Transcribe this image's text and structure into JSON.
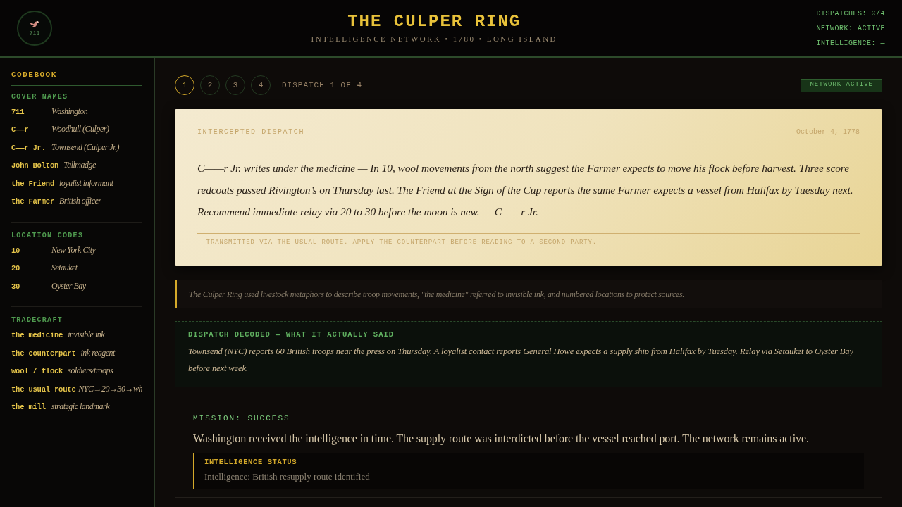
{
  "header": {
    "logo_text": "711",
    "title": "THE CULPER RING",
    "subtitle": "INTELLIGENCE NETWORK • 1780 • LONG ISLAND",
    "status": [
      "DISPATCHES: 0/4",
      "NETWORK: ACTIVE",
      "INTELLIGENCE: —"
    ]
  },
  "sidebar": {
    "title": "CODEBOOK",
    "sections": [
      {
        "title": "COVER NAMES",
        "entries": [
          {
            "code": "711",
            "meaning": "Washington"
          },
          {
            "code": "C——r",
            "meaning": "Woodhull (Culper)"
          },
          {
            "code": "C——r Jr.",
            "meaning": "Townsend (Culper Jr.)"
          },
          {
            "code": "John Bolton",
            "meaning": "Tallmadge"
          },
          {
            "code": "the Friend",
            "meaning": "loyalist informant"
          },
          {
            "code": "the Farmer",
            "meaning": "British officer"
          }
        ]
      },
      {
        "title": "LOCATION CODES",
        "entries": [
          {
            "code": "10",
            "meaning": "New York City"
          },
          {
            "code": "20",
            "meaning": "Setauket"
          },
          {
            "code": "30",
            "meaning": "Oyster Bay"
          }
        ]
      },
      {
        "title": "TRADECRAFT",
        "entries": [
          {
            "code": "the medicine",
            "meaning": "invisible ink"
          },
          {
            "code": "the counterpart",
            "meaning": "ink reagent"
          },
          {
            "code": "wool / flock",
            "meaning": "soldiers/troops"
          },
          {
            "code": "the usual route",
            "meaning": "NYC→20→30→wh"
          },
          {
            "code": "the mill",
            "meaning": "strategic landmark"
          }
        ]
      }
    ]
  },
  "dispatch_nav": {
    "steps": [
      {
        "label": "1",
        "selected": true
      },
      {
        "label": "2",
        "selected": false
      },
      {
        "label": "3",
        "selected": false
      },
      {
        "label": "4",
        "selected": false
      }
    ],
    "caption": "DISPATCH 1 OF 4",
    "badge": "NETWORK ACTIVE"
  },
  "dispatch": {
    "label": "INTERCEPTED DISPATCH",
    "date": "October 4, 1778",
    "body": "C——r Jr. writes under the medicine — In 10, wool movements from the north suggest the Farmer expects to move his flock before harvest. Three score redcoats passed Rivington’s on Thursday last. The Friend at the Sign of the Cup reports the same Farmer expects a vessel from Halifax by Tuesday next. Recommend immediate relay via 20 to 30 before the moon is new. — C——r Jr.",
    "footer": "— TRANSMITTED VIA THE USUAL ROUTE. APPLY THE COUNTERPART BEFORE READING TO A SECOND PARTY."
  },
  "note": "The Culper Ring used livestock metaphors to describe troop movements, \"the medicine\" referred to invisible ink, and numbered locations to protect sources.",
  "decoded": {
    "title": "DISPATCH DECODED — WHAT IT ACTUALLY SAID",
    "text": "Townsend (NYC) reports 60 British troops near the press on Thursday. A loyalist contact reports General Howe expects a supply ship from Halifax by Tuesday. Relay via Setauket to Oyster Bay before next week."
  },
  "mission": {
    "title": "MISSION: SUCCESS",
    "text": "Washington received the intelligence in time. The supply route was interdicted before the vessel reached port. The network remains active.",
    "status": {
      "title": "INTELLIGENCE STATUS",
      "text": "Intelligence: British resupply route identified"
    }
  }
}
